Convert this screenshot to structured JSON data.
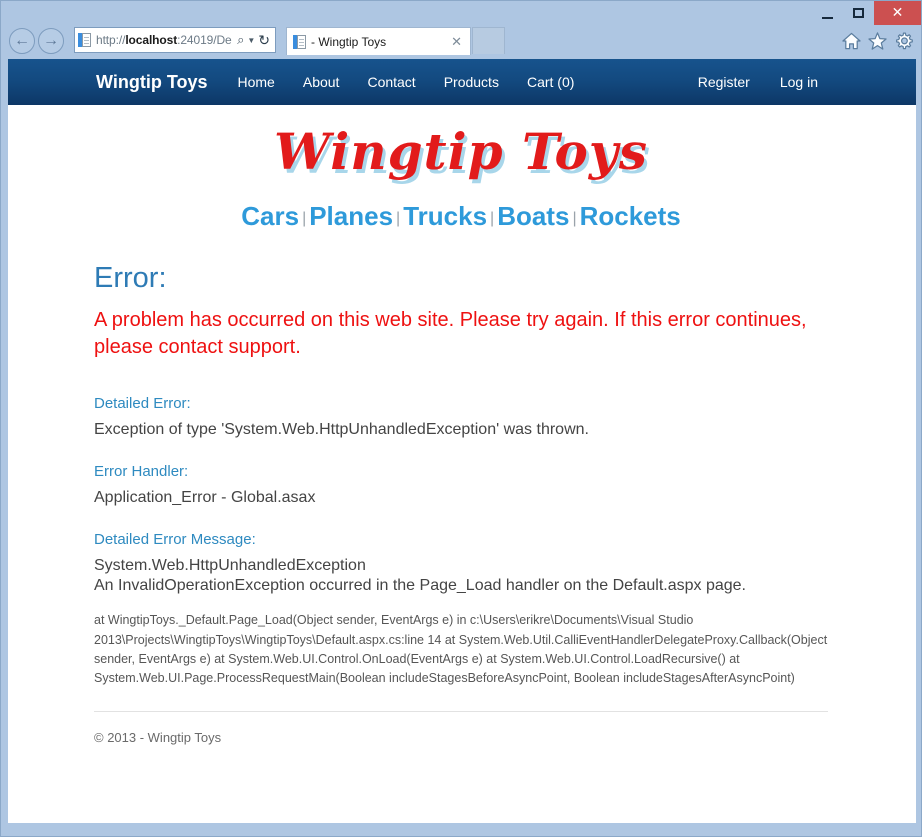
{
  "window": {
    "minimize_label": "minimize",
    "maximize_label": "maximize",
    "close_label": "✕"
  },
  "browser": {
    "back_glyph": "←",
    "forward_glyph": "→",
    "address": {
      "scheme": "http://",
      "host": "localhost",
      "rest": ":24019/De",
      "search_glyph": "⌕",
      "dropdown_glyph": "▼",
      "refresh_glyph": "↻"
    },
    "tab": {
      "title": "- Wingtip Toys",
      "close_glyph": "✕"
    },
    "toolbar_icons": [
      "home-icon",
      "favorites-icon",
      "tools-icon"
    ]
  },
  "sitenav": {
    "brand": "Wingtip Toys",
    "links": [
      {
        "label": "Home"
      },
      {
        "label": "About"
      },
      {
        "label": "Contact"
      },
      {
        "label": "Products"
      },
      {
        "label": "Cart (0)"
      }
    ],
    "right_links": [
      {
        "label": "Register"
      },
      {
        "label": "Log in"
      }
    ]
  },
  "logo": {
    "text": "Wingtip Toys",
    "color": "#e21b1b",
    "shadow_color": "#a8d6ea"
  },
  "categories": {
    "separator": "|",
    "color": "#2e9ada",
    "items": [
      {
        "label": "Cars"
      },
      {
        "label": "Planes"
      },
      {
        "label": "Trucks"
      },
      {
        "label": "Boats"
      },
      {
        "label": "Rockets"
      }
    ]
  },
  "error": {
    "title": "Error:",
    "title_color": "#2e7bb5",
    "message": "A problem has occurred on this web site. Please try again. If this error continues, please contact support.",
    "message_color": "#ee1111",
    "detailed_error_label": "Detailed Error:",
    "detailed_error_value": "Exception of type 'System.Web.HttpUnhandledException' was thrown.",
    "error_handler_label": "Error Handler:",
    "error_handler_value": "Application_Error - Global.asax",
    "detailed_message_label": "Detailed Error Message:",
    "detailed_message_value": "System.Web.HttpUnhandledException\nAn InvalidOperationException occurred in the Page_Load handler on the Default.aspx page.",
    "stack_trace": "at WingtipToys._Default.Page_Load(Object sender, EventArgs e) in c:\\Users\\erikre\\Documents\\Visual Studio 2013\\Projects\\WingtipToys\\WingtipToys\\Default.aspx.cs:line 14 at System.Web.Util.CalliEventHandlerDelegateProxy.Callback(Object sender, EventArgs e) at System.Web.UI.Control.OnLoad(EventArgs e) at System.Web.UI.Control.LoadRecursive() at System.Web.UI.Page.ProcessRequestMain(Boolean includeStagesBeforeAsyncPoint, Boolean includeStagesAfterAsyncPoint)"
  },
  "footer": {
    "text": "© 2013 - Wingtip Toys"
  }
}
